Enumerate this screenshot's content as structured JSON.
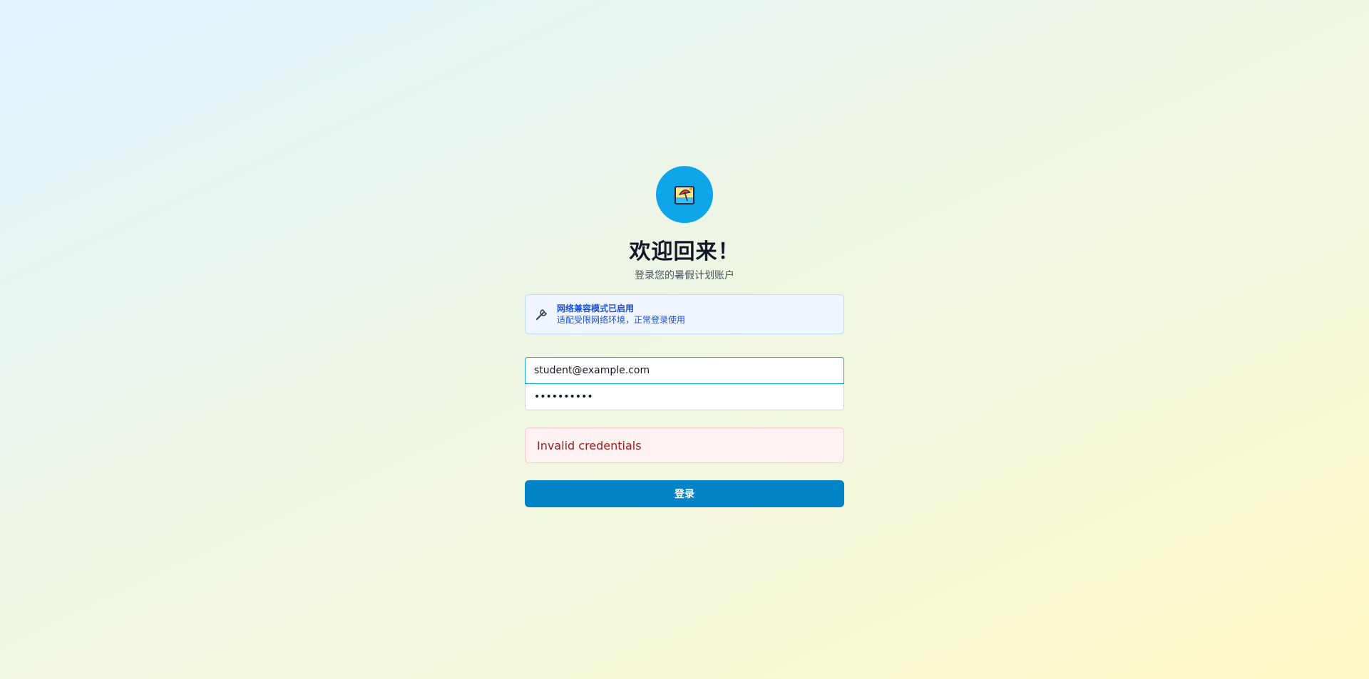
{
  "logo": {
    "icon": "beach-umbrella-icon",
    "color": "#0ea5e9"
  },
  "heading": {
    "title": "欢迎回来！",
    "subtitle": "登录您的暑假计划账户"
  },
  "notice": {
    "icon": "wrench-icon",
    "title": "网络兼容模式已启用",
    "description": "适配受限网络环境，正常登录使用"
  },
  "form": {
    "email_value": "student@example.com",
    "password_value": "••••••••••"
  },
  "error": {
    "message": "Invalid credentials"
  },
  "submit": {
    "label": "登录",
    "color": "#0284c7"
  }
}
